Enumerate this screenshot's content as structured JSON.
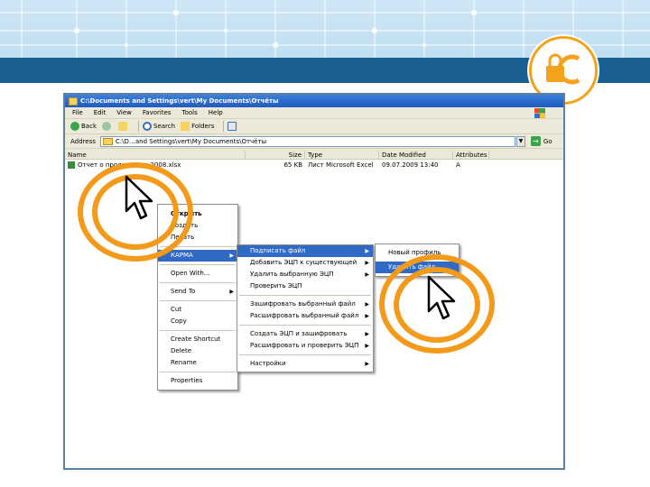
{
  "window": {
    "title": "C:\\Documents and Settings\\vert\\My Documents\\Отчёты"
  },
  "menubar": {
    "items": [
      "File",
      "Edit",
      "View",
      "Favorites",
      "Tools",
      "Help"
    ]
  },
  "toolbar": {
    "back": "Back",
    "search": "Search",
    "folders": "Folders"
  },
  "address": {
    "label": "Address",
    "value": "C:\\D…and Settings\\vert\\My Documents\\Отчёты",
    "go": "Go"
  },
  "columns": [
    "Name",
    "Size",
    "Type",
    "Date Modified",
    "Attributes"
  ],
  "files": [
    {
      "name": "Отчет о продажах за 2008.xlsx",
      "size": "65 KB",
      "type": "Лист Microsoft Excel",
      "date": "09.07.2009 13:40",
      "attr": "A"
    }
  ],
  "context_menu": {
    "group1": [
      "Открыть",
      "Создать",
      "Печать"
    ],
    "karma": "КАРМА",
    "group2": [
      "Open With...",
      "Send To"
    ],
    "group3": [
      "Cut",
      "Copy"
    ],
    "group4": [
      "Create Shortcut",
      "Delete",
      "Rename"
    ],
    "properties": "Properties"
  },
  "karma_menu": {
    "sign": "Подписать файл",
    "add_sig": "Добавить ЭЦП к существующей",
    "remove_sig": "Удалить выбранную ЭЦП",
    "verify": "Проверить ЭЦП",
    "encrypt": "Зашифровать выбранный файл",
    "decrypt": "Расшифровать выбранный файл",
    "create_encrypt": "Создать ЭЦП и зашифровать",
    "decrypt_verify": "Расшифровать и проверить ЭЦП",
    "settings": "Настройки"
  },
  "sign_menu": {
    "new_profile": "Новый профиль",
    "delete_file": "Удалить файл"
  },
  "colors": {
    "ring": "#f39a1b",
    "highlight": "#316ac5",
    "titlebar": "#1f5bc0"
  }
}
